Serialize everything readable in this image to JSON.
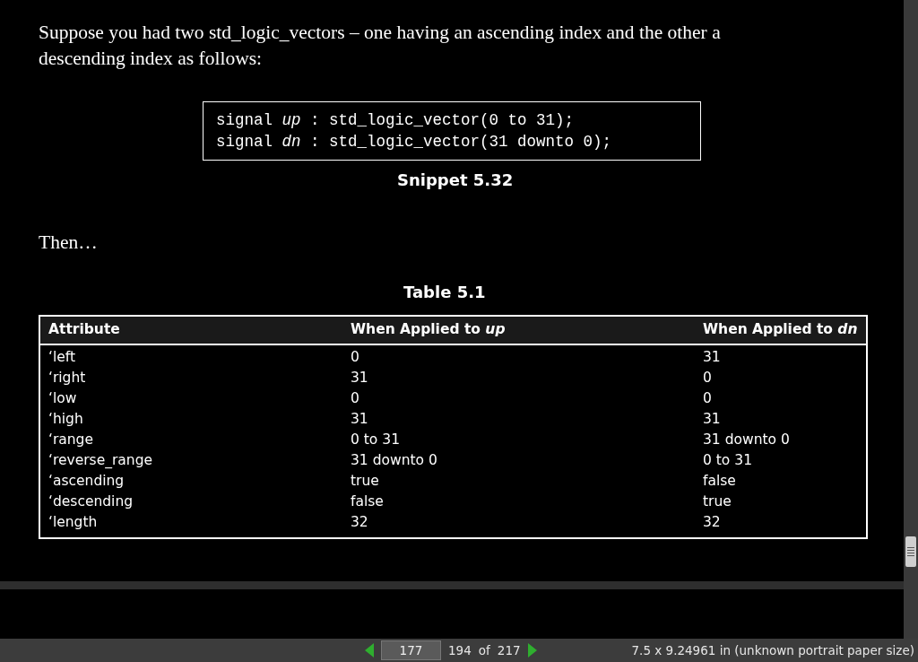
{
  "page": {
    "paragraph": "Suppose you had two std_logic_vectors – one having an ascending index and the other a descending index as follows:",
    "code_lines": [
      "signal *up* : std_logic_vector(0 to 31);",
      "signal *dn* : std_logic_vector(31 downto 0);"
    ],
    "snippet_caption": "Snippet 5.32",
    "then_text": "Then…",
    "table_caption": "Table 5.1",
    "table": {
      "columns": [
        "Attribute",
        "When Applied to *up*",
        "When Applied to *dn*"
      ],
      "rows": [
        [
          "‘left",
          "0",
          "31"
        ],
        [
          "‘right",
          "31",
          "0"
        ],
        [
          "‘low",
          "0",
          "0"
        ],
        [
          "‘high",
          "31",
          "31"
        ],
        [
          "‘range",
          "0 to 31",
          "31 downto 0"
        ],
        [
          "‘reverse_range",
          "31 downto 0",
          "0 to 31"
        ],
        [
          "‘ascending",
          "true",
          "false"
        ],
        [
          "‘descending",
          "false",
          "true"
        ],
        [
          "‘length",
          "32",
          "32"
        ]
      ]
    }
  },
  "status_bar": {
    "page_input": "177",
    "page_label": "194",
    "of_label": "of",
    "total_pages": "217",
    "paper_size": "7.5 x 9.24961 in (unknown portrait paper size)"
  }
}
